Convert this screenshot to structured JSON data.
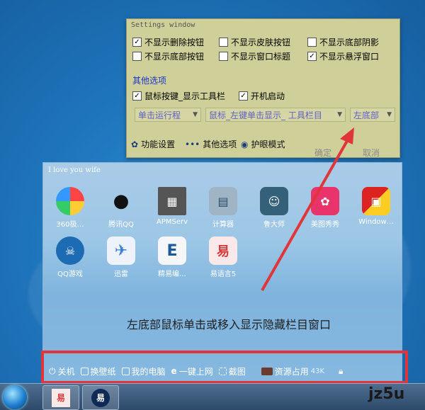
{
  "settings": {
    "title": "Settings window",
    "checks": [
      {
        "label": "不显示删除按钮",
        "checked": true
      },
      {
        "label": "不显示皮肤按钮",
        "checked": false
      },
      {
        "label": "不显示底部阴影",
        "checked": false
      },
      {
        "label": "不显示底部按钮",
        "checked": false
      },
      {
        "label": "不显示窗口标题",
        "checked": false
      },
      {
        "label": "不显示悬浮窗口",
        "checked": true
      }
    ],
    "section_label": "其他选项",
    "other_checks": [
      {
        "label": "鼠标按键_显示工具栏",
        "checked": true
      },
      {
        "label": "开机启动",
        "checked": true
      }
    ],
    "selects": [
      {
        "value": "单击运行程"
      },
      {
        "value": "鼠标_左键单击显示_ 工具栏目"
      },
      {
        "value": "左底部"
      }
    ],
    "actions": [
      {
        "label": "功能设置",
        "icon": "gear-icon"
      },
      {
        "label": "其他选项",
        "icon": "dots-icon"
      },
      {
        "label": "护眼模式",
        "icon": "eye-icon"
      }
    ],
    "ok_label": "确定",
    "cancel_label": "取消"
  },
  "panel": {
    "title": "I love you wife",
    "apps": [
      {
        "label": "360极…",
        "icon": "360-browser-icon",
        "color": "#f0a030"
      },
      {
        "label": "腾讯QQ",
        "icon": "qq-penguin-icon",
        "color": "#1b1b1b"
      },
      {
        "label": "APMServ",
        "icon": "apmserv-icon",
        "color": "#444444"
      },
      {
        "label": "计算器",
        "icon": "calculator-icon",
        "color": "#8a9fb0"
      },
      {
        "label": "鲁大师",
        "icon": "ludashi-icon",
        "color": "#3c6f88"
      },
      {
        "label": "美图秀秀",
        "icon": "meitu-icon",
        "color": "#e8336b"
      },
      {
        "label": "Window…",
        "icon": "windows-cube-icon",
        "color": "#cc2222"
      },
      {
        "label": "QQ游戏",
        "icon": "qq-game-icon",
        "color": "#1c6bb3"
      },
      {
        "label": "迅雷",
        "icon": "xunlei-bird-icon",
        "color": "#3b7fd8"
      },
      {
        "label": "精易编…",
        "icon": "jingyi-editor-icon",
        "color": "#1a5a9a"
      },
      {
        "label": "易语言5",
        "icon": "eyuyan-icon",
        "color": "#d83a3a"
      }
    ],
    "caption": "左底部鼠标单击或移入显示隐藏栏目窗口",
    "toolbar": [
      {
        "label": "关机",
        "icon": "power-icon"
      },
      {
        "label": "换壁纸",
        "icon": "wallpaper-icon"
      },
      {
        "label": "我的电脑",
        "icon": "computer-icon"
      },
      {
        "label": "一键上网",
        "icon": "ie-icon"
      },
      {
        "label": "截图",
        "icon": "screenshot-icon"
      },
      {
        "label": "资源占用",
        "icon": "resource-icon"
      },
      {
        "label": "43K",
        "icon": ""
      }
    ]
  },
  "taskbar": {
    "items": [
      {
        "icon": "start-orb-icon"
      },
      {
        "icon": "eyuyan-taskbar-icon"
      },
      {
        "icon": "yi-taskbar-icon"
      }
    ],
    "watermark": "jz5u"
  }
}
